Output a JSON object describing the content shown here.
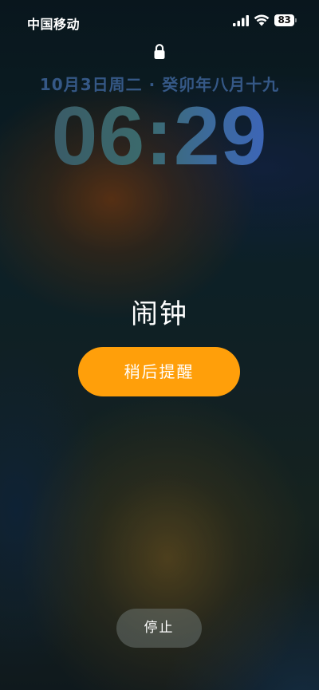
{
  "status_bar": {
    "carrier": "中国移动",
    "battery_level": "83",
    "icons": [
      "signal-icon",
      "wifi-icon",
      "battery-icon"
    ]
  },
  "lock_screen": {
    "lock_icon": "lock-icon",
    "date": "10月3日周二 · 癸卯年八月十九",
    "time": "06:29"
  },
  "alarm": {
    "title": "闹钟",
    "snooze_label": "稍后提醒",
    "stop_label": "停止"
  },
  "colors": {
    "snooze_button": "#ff9f0a",
    "date_text": "#385c8c",
    "clock_gradient": [
      "#3a5866",
      "#3d64c2"
    ]
  }
}
